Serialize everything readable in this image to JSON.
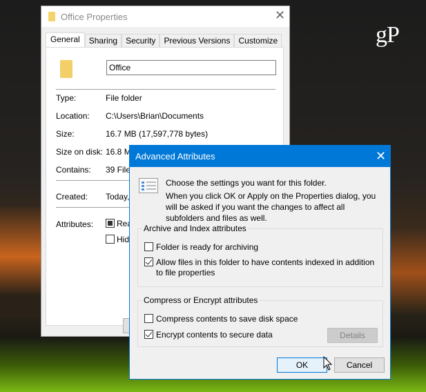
{
  "watermark": "gP",
  "properties": {
    "title": "Office Properties",
    "tabs": [
      "General",
      "Sharing",
      "Security",
      "Previous Versions",
      "Customize"
    ],
    "active_tab": "General",
    "name_value": "Office",
    "fields": [
      {
        "label": "Type:",
        "value": "File folder"
      },
      {
        "label": "Location:",
        "value": "C:\\Users\\Brian\\Documents"
      },
      {
        "label": "Size:",
        "value": "16.7 MB (17,597,778 bytes)"
      },
      {
        "label": "Size on disk:",
        "value": "16.8 M"
      },
      {
        "label": "Contains:",
        "value": "39 Files"
      },
      {
        "label": "Created:",
        "value": "Today,"
      }
    ],
    "attributes_label": "Attributes:",
    "attributes": [
      {
        "label": "Rea",
        "state": "indeterminate"
      },
      {
        "label": "Hid",
        "state": "unchecked"
      }
    ]
  },
  "advanced": {
    "title": "Advanced Attributes",
    "intro": "Choose the settings you want for this folder.",
    "note": "When you click OK or Apply on the Properties dialog, you will be asked if you want the changes to affect all subfolders and files as well.",
    "archive_group": {
      "title": "Archive and Index attributes",
      "options": [
        {
          "label": "Folder is ready for archiving",
          "checked": false
        },
        {
          "label": "Allow files in this folder to have contents indexed in addition to file properties",
          "checked": true
        }
      ]
    },
    "compress_group": {
      "title": "Compress or Encrypt attributes",
      "options": [
        {
          "label": "Compress contents to save disk space",
          "checked": false
        },
        {
          "label": "Encrypt contents to secure data",
          "checked": true
        }
      ],
      "details_label": "Details"
    },
    "ok_label": "OK",
    "cancel_label": "Cancel"
  },
  "colors": {
    "accent": "#0078d7",
    "dialog_bg": "#f0f0f0"
  }
}
